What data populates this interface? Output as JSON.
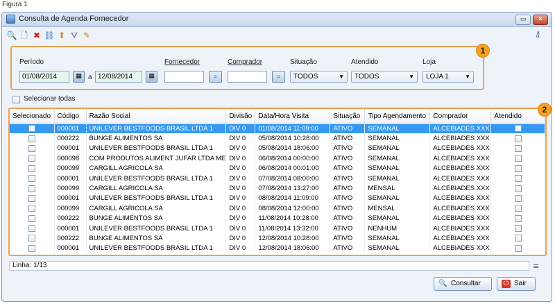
{
  "figure_label": "Figura 1",
  "window": {
    "title": "Consulta de Agenda Fornecedor",
    "minimize_glyph": "▭",
    "close_glyph": "✕"
  },
  "toolbar": {
    "icons": [
      {
        "name": "search-icon",
        "glyph": "🔍"
      },
      {
        "name": "new-document-icon",
        "glyph": "🗋"
      },
      {
        "name": "delete-icon",
        "glyph": "✖"
      },
      {
        "name": "link-icon",
        "glyph": "⛓"
      },
      {
        "name": "export-icon",
        "glyph": "⬆"
      },
      {
        "name": "filter-icon",
        "glyph": "⛛"
      },
      {
        "name": "edit-icon",
        "glyph": "✎"
      }
    ],
    "key_glyph": "⚷"
  },
  "filters": {
    "badge": "1",
    "periodo_label": "Período",
    "date_from": "01/08/2014",
    "date_sep": "a",
    "date_to": "12/08/2014",
    "fornecedor_label": "Fornecedor",
    "comprador_label": "Comprador",
    "situacao_label": "Situação",
    "situacao_value": "TODOS",
    "atendido_label": "Atendido",
    "atendido_value": "TODOS",
    "loja_label": "Loja",
    "loja_value": "LOJA 1",
    "dropdown_glyph": "▼",
    "calendar_glyph": "▦",
    "search_glyph": "⌕"
  },
  "select_all_label": "Selecionar todas",
  "grid": {
    "badge": "2",
    "columns": [
      "Selecionado",
      "Código",
      "Razão Social",
      "Divisão",
      "Data/Hora Visita",
      "Situação",
      "Tipo Agendamento",
      "Comprador",
      "Atendido"
    ],
    "rows": [
      {
        "codigo": "000001",
        "razao": "UNILEVER BESTFOODS BRASIL LTDA 1",
        "divisao": "DIV 0",
        "data": "01/08/2014 11:09:00",
        "situacao": "ATIVO",
        "tipo": "SEMANAL",
        "comprador": "ALCEBIADES XXX"
      },
      {
        "codigo": "000222",
        "razao": "BUNGE ALIMENTOS SA",
        "divisao": "DIV 0",
        "data": "05/08/2014 10:28:00",
        "situacao": "ATIVO",
        "tipo": "SEMANAL",
        "comprador": "ALCEBIADES XXX"
      },
      {
        "codigo": "000001",
        "razao": "UNILEVER BESTFOODS BRASIL LTDA 1",
        "divisao": "DIV 0",
        "data": "05/08/2014 18:06:00",
        "situacao": "ATIVO",
        "tipo": "SEMANAL",
        "comprador": "ALCEBIADES XXX"
      },
      {
        "codigo": "000098",
        "razao": "COM PRODUTOS ALIMENT JUFAR LTDA ME",
        "divisao": "DIV 0",
        "data": "06/08/2014 00:00:00",
        "situacao": "ATIVO",
        "tipo": "SEMANAL",
        "comprador": "ALCEBIADES XXX"
      },
      {
        "codigo": "000099",
        "razao": "CARGILL AGRICOLA SA",
        "divisao": "DIV 0",
        "data": "06/08/2014 00:01:00",
        "situacao": "ATIVO",
        "tipo": "SEMANAL",
        "comprador": "ALCEBIADES XXX"
      },
      {
        "codigo": "000001",
        "razao": "UNILEVER BESTFOODS BRASIL LTDA 1",
        "divisao": "DIV 0",
        "data": "07/08/2014 08:00:00",
        "situacao": "ATIVO",
        "tipo": "SEMANAL",
        "comprador": "ALCEBIADES XXX"
      },
      {
        "codigo": "000099",
        "razao": "CARGILL AGRICOLA SA",
        "divisao": "DIV 0",
        "data": "07/08/2014 13:27:00",
        "situacao": "ATIVO",
        "tipo": "MENSAL",
        "comprador": "ALCEBIADES XXX"
      },
      {
        "codigo": "000001",
        "razao": "UNILEVER BESTFOODS BRASIL LTDA 1",
        "divisao": "DIV 0",
        "data": "08/08/2014 11:09:00",
        "situacao": "ATIVO",
        "tipo": "SEMANAL",
        "comprador": "ALCEBIADES XXX"
      },
      {
        "codigo": "000099",
        "razao": "CARGILL AGRICOLA SA",
        "divisao": "DIV 0",
        "data": "08/08/2014 12:00:00",
        "situacao": "ATIVO",
        "tipo": "MENSAL",
        "comprador": "ALCEBIADES XXX"
      },
      {
        "codigo": "000222",
        "razao": "BUNGE ALIMENTOS SA",
        "divisao": "DIV 0",
        "data": "11/08/2014 10:28:00",
        "situacao": "ATIVO",
        "tipo": "SEMANAL",
        "comprador": "ALCEBIADES XXX"
      },
      {
        "codigo": "000001",
        "razao": "UNILEVER BESTFOODS BRASIL LTDA 1",
        "divisao": "DIV 0",
        "data": "11/08/2014 13:32:00",
        "situacao": "ATIVO",
        "tipo": "NENHUM",
        "comprador": "ALCEBIADES XXX"
      },
      {
        "codigo": "000222",
        "razao": "BUNGE ALIMENTOS SA",
        "divisao": "DIV 0",
        "data": "12/08/2014 10:28:00",
        "situacao": "ATIVO",
        "tipo": "SEMANAL",
        "comprador": "ALCEBIADES XXX"
      },
      {
        "codigo": "000001",
        "razao": "UNILEVER BESTFOODS BRASIL LTDA 1",
        "divisao": "DIV 0",
        "data": "12/08/2014 18:06:00",
        "situacao": "ATIVO",
        "tipo": "SEMANAL",
        "comprador": "ALCEBIADES XXX"
      }
    ],
    "selected_row": 0,
    "selected_color": "#3399f3"
  },
  "status": {
    "linha": "Linha: 1/13",
    "menu_glyph": "≡"
  },
  "buttons": {
    "consultar": {
      "label": "Consultar",
      "icon": "search-icon",
      "glyph": "🔍"
    },
    "sair": {
      "label": "Sair",
      "icon": "exit-icon",
      "glyph": "⏻"
    }
  },
  "colors": {
    "highlight_border": "#f0a050",
    "badge_fill": "#f6a21e",
    "window_bg": "#eef3fa"
  }
}
